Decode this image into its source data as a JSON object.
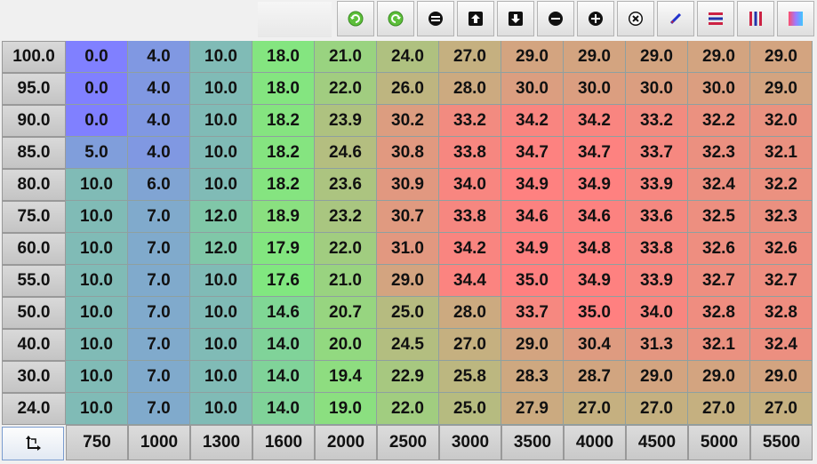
{
  "toolbar": {
    "buttons": [
      {
        "name": "undo-button",
        "icon": "undo-icon"
      },
      {
        "name": "redo-button",
        "icon": "redo-icon"
      },
      {
        "name": "set-equal-button",
        "icon": "equals-icon"
      },
      {
        "name": "increment-up-button",
        "icon": "arrow-up-icon"
      },
      {
        "name": "increment-down-button",
        "icon": "arrow-down-icon"
      },
      {
        "name": "subtract-button",
        "icon": "minus-icon"
      },
      {
        "name": "add-button",
        "icon": "plus-icon"
      },
      {
        "name": "multiply-button",
        "icon": "multiply-icon"
      },
      {
        "name": "interpolate-button",
        "icon": "pencil-icon"
      },
      {
        "name": "horizontal-interpolate-button",
        "icon": "horizontal-lines-icon"
      },
      {
        "name": "vertical-interpolate-button",
        "icon": "vertical-lines-icon"
      },
      {
        "name": "color-map-button",
        "icon": "color-gradient-icon"
      }
    ]
  },
  "table": {
    "row_labels": [
      "100.0",
      "95.0",
      "90.0",
      "85.0",
      "80.0",
      "75.0",
      "60.0",
      "55.0",
      "50.0",
      "40.0",
      "30.0",
      "24.0"
    ],
    "col_labels": [
      "750",
      "1000",
      "1300",
      "1600",
      "2000",
      "2500",
      "3000",
      "3500",
      "4000",
      "4500",
      "5000",
      "5500"
    ],
    "values": [
      [
        "0.0",
        "4.0",
        "10.0",
        "18.0",
        "21.0",
        "24.0",
        "27.0",
        "29.0",
        "29.0",
        "29.0",
        "29.0",
        "29.0"
      ],
      [
        "0.0",
        "4.0",
        "10.0",
        "18.0",
        "22.0",
        "26.0",
        "28.0",
        "30.0",
        "30.0",
        "30.0",
        "30.0",
        "29.0"
      ],
      [
        "0.0",
        "4.0",
        "10.0",
        "18.2",
        "23.9",
        "30.2",
        "33.2",
        "34.2",
        "34.2",
        "33.2",
        "32.2",
        "32.0"
      ],
      [
        "5.0",
        "4.0",
        "10.0",
        "18.2",
        "24.6",
        "30.8",
        "33.8",
        "34.7",
        "34.7",
        "33.7",
        "32.3",
        "32.1"
      ],
      [
        "10.0",
        "6.0",
        "10.0",
        "18.2",
        "23.6",
        "30.9",
        "34.0",
        "34.9",
        "34.9",
        "33.9",
        "32.4",
        "32.2"
      ],
      [
        "10.0",
        "7.0",
        "12.0",
        "18.9",
        "23.2",
        "30.7",
        "33.8",
        "34.6",
        "34.6",
        "33.6",
        "32.5",
        "32.3"
      ],
      [
        "10.0",
        "7.0",
        "12.0",
        "17.9",
        "22.0",
        "31.0",
        "34.2",
        "34.9",
        "34.8",
        "33.8",
        "32.6",
        "32.6"
      ],
      [
        "10.0",
        "7.0",
        "10.0",
        "17.6",
        "21.0",
        "29.0",
        "34.4",
        "35.0",
        "34.9",
        "33.9",
        "32.7",
        "32.7"
      ],
      [
        "10.0",
        "7.0",
        "10.0",
        "14.6",
        "20.7",
        "25.0",
        "28.0",
        "33.7",
        "35.0",
        "34.0",
        "32.8",
        "32.8"
      ],
      [
        "10.0",
        "7.0",
        "10.0",
        "14.0",
        "20.0",
        "24.5",
        "27.0",
        "29.0",
        "30.4",
        "31.3",
        "32.1",
        "32.4"
      ],
      [
        "10.0",
        "7.0",
        "10.0",
        "14.0",
        "19.4",
        "22.9",
        "25.8",
        "28.3",
        "28.7",
        "29.0",
        "29.0",
        "29.0"
      ],
      [
        "10.0",
        "7.0",
        "10.0",
        "14.0",
        "19.0",
        "22.0",
        "25.0",
        "27.9",
        "27.0",
        "27.0",
        "27.0",
        "27.0"
      ]
    ],
    "corner_icon": "swap-axes-icon"
  },
  "colors": {
    "low": "#8080ff",
    "mid": "#80e880",
    "high": "#ff8080"
  }
}
